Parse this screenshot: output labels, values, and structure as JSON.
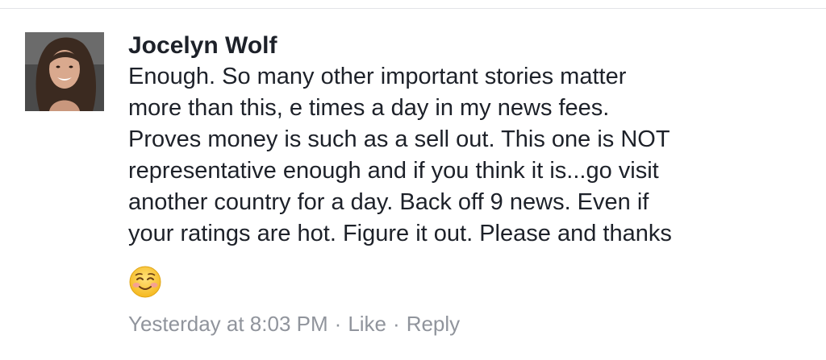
{
  "comment": {
    "author": "Jocelyn Wolf",
    "text_lines": [
      "Enough. So many other important stories matter",
      "more than this, e times a day in my news fees.",
      "Proves money is such as a sell out. This one is NOT",
      "representative enough and if you think it is...go visit",
      "another country for a day. Back off 9 news. Even if",
      "your ratings are hot. Figure it out. Please and thanks"
    ],
    "emoji": "smiling-face-with-rosy-cheeks",
    "timestamp": "Yesterday at 8:03 PM",
    "separator": "·",
    "like_label": "Like",
    "reply_label": "Reply"
  },
  "colors": {
    "author_text": "#1d2129",
    "body_text": "#1d2129",
    "meta_text": "#90949c",
    "emoji_face": "#f7c948"
  }
}
